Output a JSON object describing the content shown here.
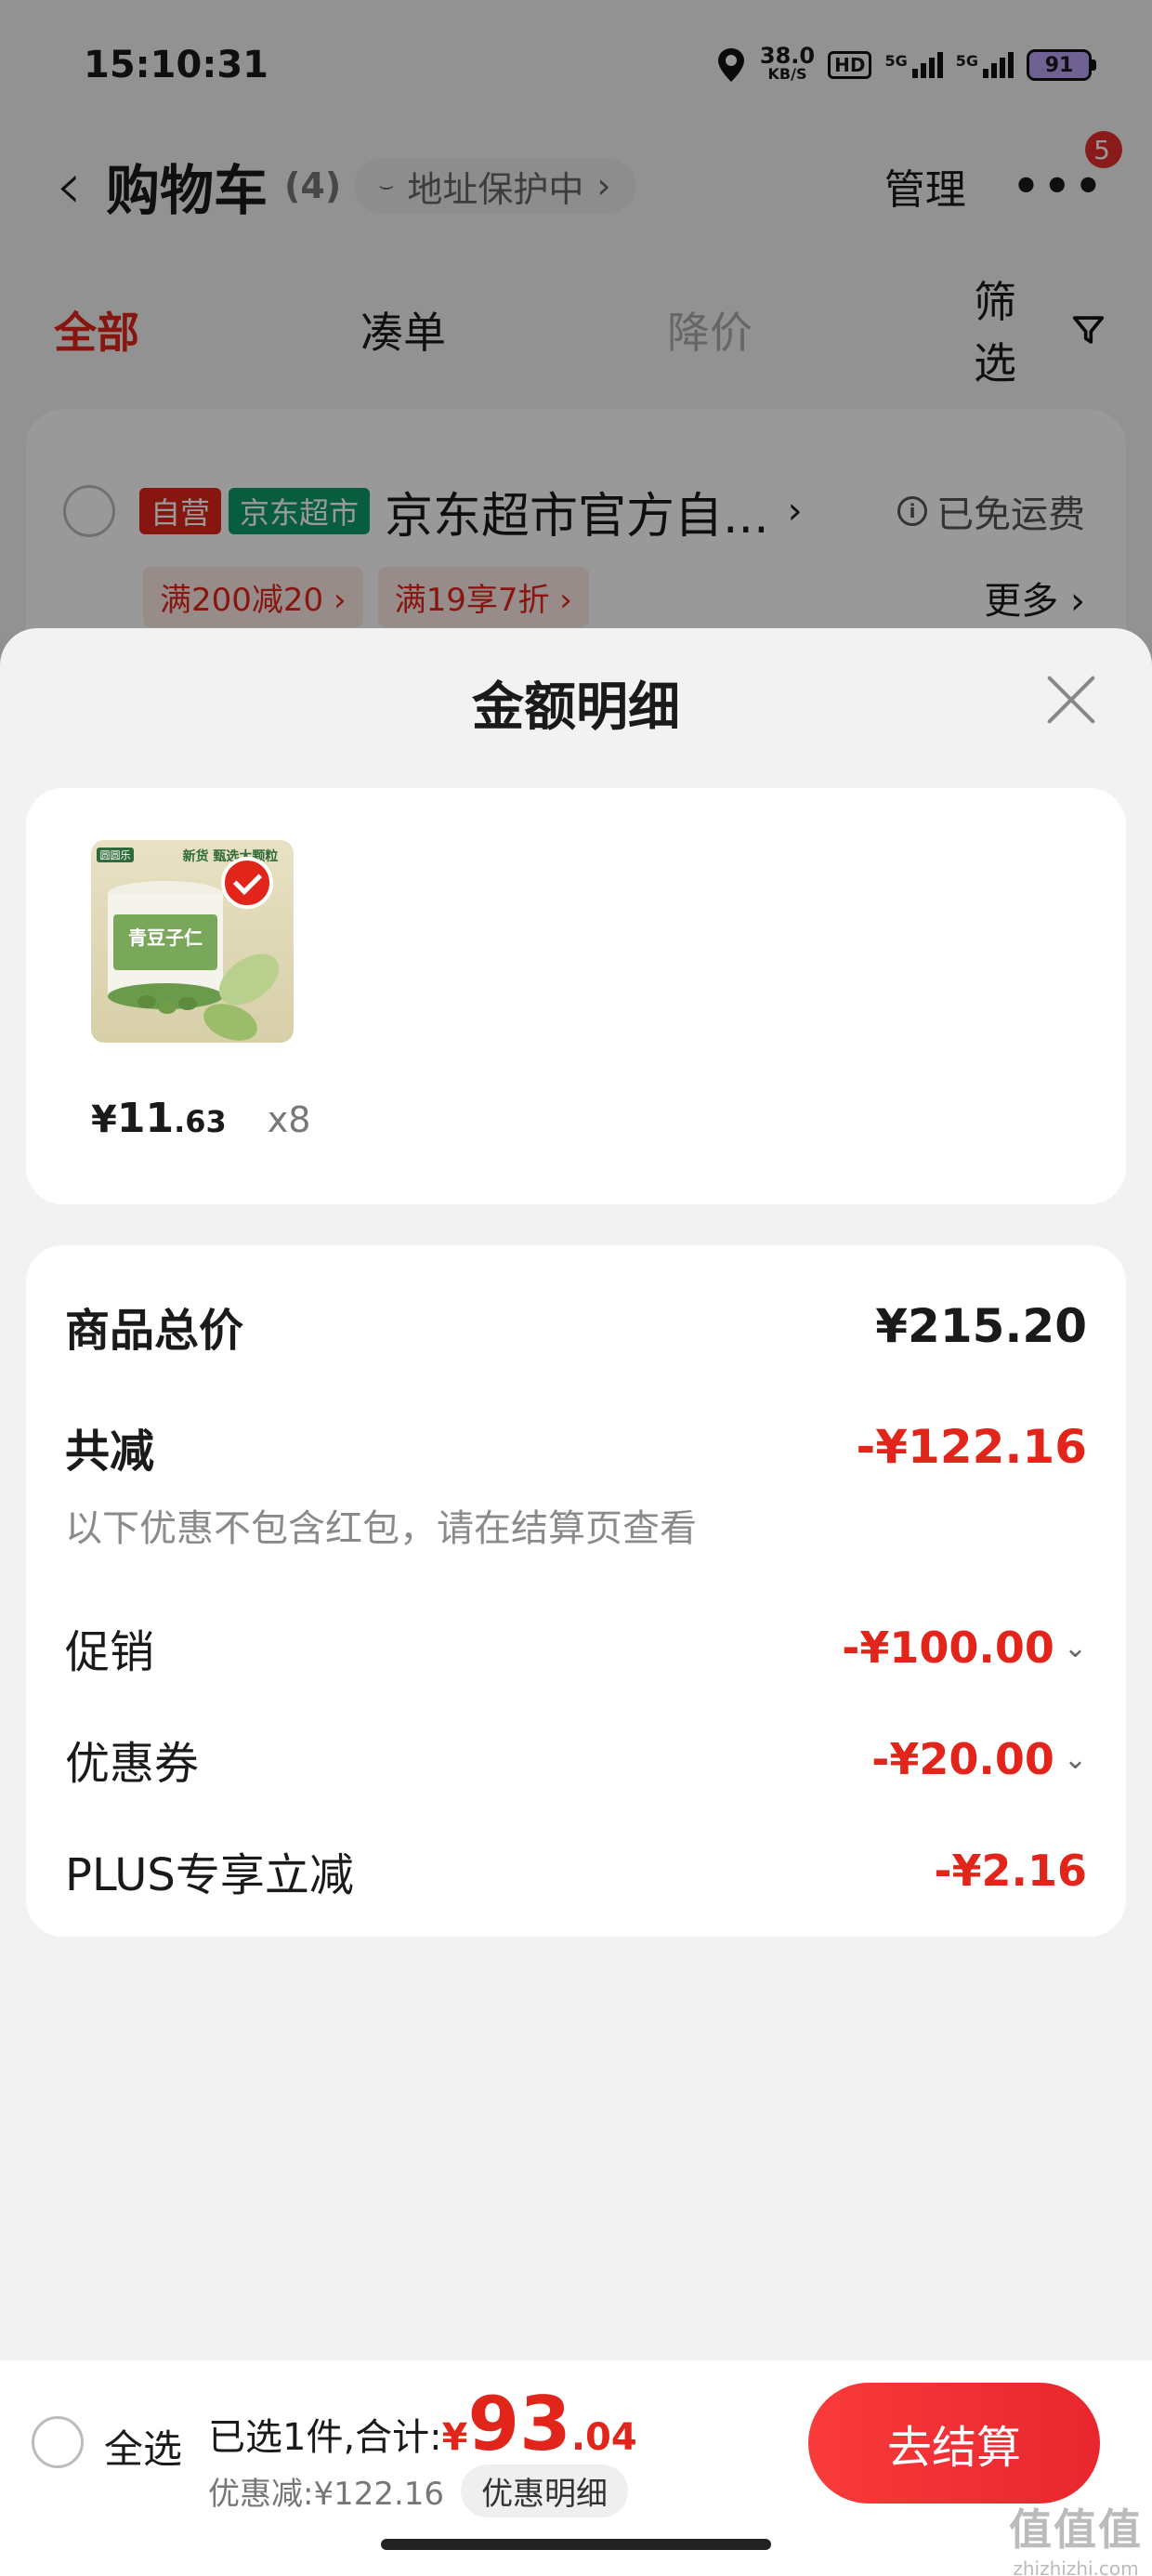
{
  "status": {
    "time": "15:10:31",
    "net_speed": "38.0",
    "net_unit": "KB/S",
    "hd": "HD",
    "sig1": "5G",
    "sig2": "5G",
    "battery": "91"
  },
  "header": {
    "back": "‹",
    "title": "购物车",
    "count": "(4)",
    "addr_label": "地址保护中",
    "manage": "管理",
    "more_badge": "5"
  },
  "tabs": [
    {
      "label": "全部"
    },
    {
      "label": "凑单"
    },
    {
      "label": "降价"
    },
    {
      "label": "筛选"
    }
  ],
  "shop": {
    "tag_self": "自营",
    "tag_market": "京东超市",
    "name": "京东超市官方自...",
    "free_shipping": "已免运费",
    "promos": [
      "满200减20 ›",
      "满19享7折 ›"
    ],
    "more": "更多 ›"
  },
  "sheet": {
    "title": "金额明细",
    "item": {
      "price_cur": "¥",
      "price_int": "11",
      "price_dec": ".63",
      "qty": "x8",
      "pkg_brand": "圆圆乐",
      "pkg_line1": "新货 甄选大颗粒",
      "pkg_name": "青豆子仁"
    },
    "rows": {
      "total_label": "商品总价",
      "total_value": "¥215.20",
      "reduce_label": "共减",
      "reduce_value": "-¥122.16",
      "note": "以下优惠不包含红包，请在结算页查看",
      "promo_label": "促销",
      "promo_value": "-¥100.00",
      "coupon_label": "优惠券",
      "coupon_value": "-¥20.00",
      "plus_label": "PLUS专享立减",
      "plus_value": "-¥2.16"
    }
  },
  "bottom": {
    "select_all": "全选",
    "summary": "已选1件,合计:",
    "total_cur": "¥",
    "total_int": "93",
    "total_dec": ".04",
    "discount": "优惠减:¥122.16",
    "detail_btn": "优惠明细",
    "checkout": "去结算"
  },
  "watermark": {
    "logo": "值值值",
    "domain": "zhizhizhi.com"
  },
  "colors": {
    "accent": "#e1251b",
    "green_tag": "#0e9b6a",
    "battery": "#b9a3f3"
  }
}
